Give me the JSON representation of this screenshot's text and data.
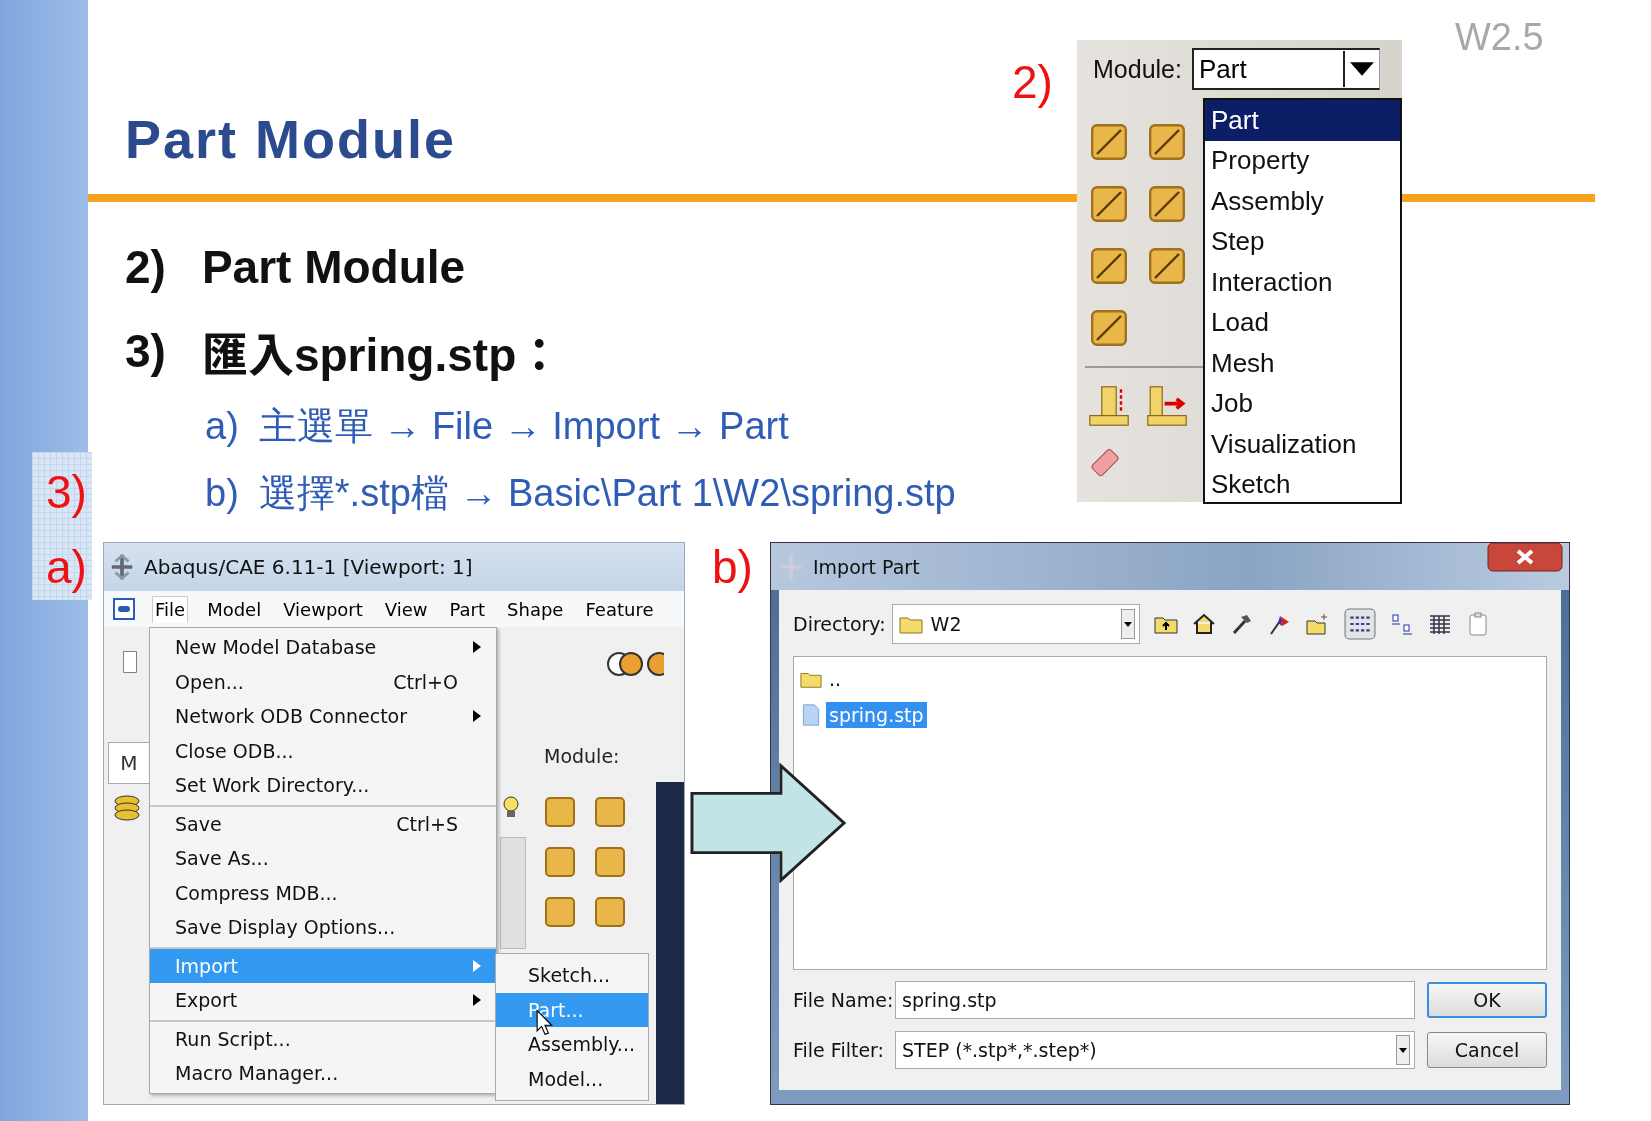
{
  "slide": {
    "version": "W2.5",
    "title": "Part Module",
    "steps": [
      {
        "number": "2)",
        "text": "Part Module"
      },
      {
        "number": "3)",
        "text": "匯入spring.stp："
      }
    ],
    "substeps": [
      {
        "letter": "a)",
        "text": "主選單 → File → Import → Part"
      },
      {
        "letter": "b)",
        "text": "選擇*.stp檔 → Basic\\Part 1\\W2\\spring.stp"
      }
    ],
    "callouts": {
      "module": "2)",
      "window_step": "3)",
      "window": "a)",
      "dialog": "b)"
    }
  },
  "module_panel": {
    "label": "Module:",
    "value": "Part",
    "options": [
      {
        "label": "Part",
        "selected": true
      },
      {
        "label": "Property",
        "selected": false
      },
      {
        "label": "Assembly",
        "selected": false
      },
      {
        "label": "Step",
        "selected": false
      },
      {
        "label": "Interaction",
        "selected": false
      },
      {
        "label": "Load",
        "selected": false
      },
      {
        "label": "Mesh",
        "selected": false
      },
      {
        "label": "Job",
        "selected": false
      },
      {
        "label": "Visualization",
        "selected": false
      },
      {
        "label": "Sketch",
        "selected": false
      }
    ]
  },
  "abaqus_window": {
    "title": "Abaqus/CAE 6.11-1 [Viewport: 1]",
    "menubar": [
      {
        "label": "File",
        "selected": true
      },
      {
        "label": "Model",
        "selected": false
      },
      {
        "label": "Viewport",
        "selected": false
      },
      {
        "label": "View",
        "selected": false
      },
      {
        "label": "Part",
        "selected": false
      },
      {
        "label": "Shape",
        "selected": false
      },
      {
        "label": "Feature",
        "selected": false
      }
    ],
    "tab_label": "M",
    "module_label": "Module:",
    "file_menu": [
      {
        "label": "New Model Database",
        "submenu": true,
        "separator_before": false,
        "selected": false
      },
      {
        "label": "Open...",
        "shortcut": "Ctrl+O",
        "submenu": false,
        "separator_before": false,
        "selected": false
      },
      {
        "label": "Network ODB Connector",
        "submenu": true,
        "separator_before": false,
        "selected": false
      },
      {
        "label": "Close ODB...",
        "submenu": false,
        "separator_before": false,
        "selected": false
      },
      {
        "label": "Set Work Directory...",
        "submenu": false,
        "separator_before": false,
        "selected": false
      },
      {
        "label": "Save",
        "shortcut": "Ctrl+S",
        "submenu": false,
        "separator_before": true,
        "selected": false
      },
      {
        "label": "Save As...",
        "submenu": false,
        "separator_before": false,
        "selected": false
      },
      {
        "label": "Compress MDB...",
        "submenu": false,
        "separator_before": false,
        "selected": false
      },
      {
        "label": "Save Display Options...",
        "submenu": false,
        "separator_before": false,
        "selected": false
      },
      {
        "label": "Import",
        "submenu": true,
        "separator_before": true,
        "selected": true
      },
      {
        "label": "Export",
        "submenu": true,
        "separator_before": false,
        "selected": false
      },
      {
        "label": "Run Script...",
        "submenu": false,
        "separator_before": true,
        "selected": false
      },
      {
        "label": "Macro Manager...",
        "submenu": false,
        "separator_before": false,
        "selected": false
      }
    ],
    "import_submenu": [
      {
        "label": "Sketch...",
        "selected": false
      },
      {
        "label": "Part...",
        "selected": true
      },
      {
        "label": "Assembly...",
        "selected": false
      },
      {
        "label": "Model...",
        "selected": false
      }
    ]
  },
  "import_dialog": {
    "title": "Import Part",
    "directory_label": "Directory:",
    "directory": "W2",
    "files": [
      {
        "name": "..",
        "kind": "folder",
        "selected": false
      },
      {
        "name": "spring.stp",
        "kind": "file",
        "selected": true
      }
    ],
    "file_name_label": "File Name:",
    "file_name": "spring.stp",
    "file_filter_label": "File Filter:",
    "file_filter": "STEP (*.stp*,*.step*)",
    "ok_button": "OK",
    "cancel_button": "Cancel"
  }
}
